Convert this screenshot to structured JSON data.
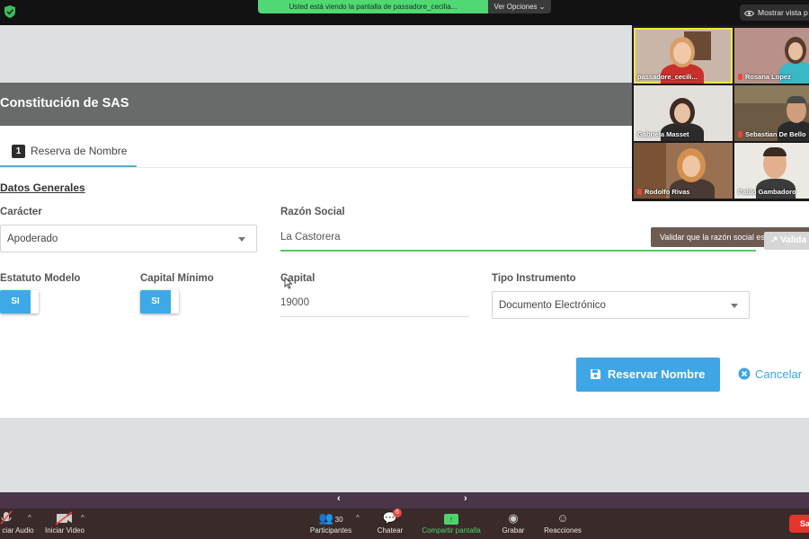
{
  "zoom": {
    "share_banner": "Usted está viendo la pantalla de passadore_cecilia...",
    "view_options": "Ver Opciones",
    "show_view": "Mostrar vista p",
    "toolbar": {
      "audio": "ciar Audio",
      "video": "Iniciar Video",
      "participants": "Participantes",
      "participants_count": "30",
      "chat": "Chatear",
      "chat_badge": "6",
      "share": "Compartir pantalla",
      "record": "Grabar",
      "reactions": "Reacciones",
      "end": "Sa"
    },
    "participants": [
      {
        "name": "passadore_cecili..."
      },
      {
        "name": "Rosana Lopez"
      },
      {
        "name": "Gabriela Masset"
      },
      {
        "name": "Sebastian De Bello"
      },
      {
        "name": "Rodolfo Rivas"
      },
      {
        "name": "Pablo Gambadoro"
      }
    ]
  },
  "app": {
    "title": "Constitución de SAS",
    "tab": {
      "number": "1",
      "label": "Reserva de Nombre"
    },
    "section_title": "Datos Generales",
    "fields": {
      "caracter": {
        "label": "Carácter",
        "value": "Apoderado"
      },
      "razon_social": {
        "label": "Razón Social",
        "value": "La Castorera"
      },
      "estatuto_modelo": {
        "label": "Estatuto Modelo",
        "value": "SI"
      },
      "capital_minimo": {
        "label": "Capital Mínimo",
        "value": "SI"
      },
      "capital": {
        "label": "Capital",
        "value": "19000"
      },
      "tipo_instrumento": {
        "label": "Tipo Instrumento",
        "value": "Documento Electrónico"
      }
    },
    "validar_button": "Valida",
    "tooltip": "Validar que la razón social esté dispo",
    "reserve_button": "Reservar Nombre",
    "cancel_button": "Cancelar"
  }
}
